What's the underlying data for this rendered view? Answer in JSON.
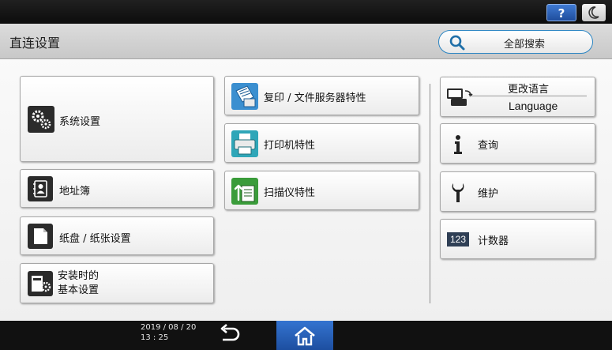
{
  "topbar": {
    "help_label": "?"
  },
  "header": {
    "title": "直连设置",
    "search_label": "全部搜索"
  },
  "tiles": {
    "system_settings": "系统设置",
    "address_book": "地址簿",
    "tray_paper": "纸盘 / 纸张设置",
    "install_basic_line1": "安装时的",
    "install_basic_line2": "基本设置",
    "copier_doc_server": "复印 / 文件服务器特性",
    "printer_features": "打印机特性",
    "scanner_features": "扫描仪特性",
    "change_language": "更改语言",
    "language": "Language",
    "inquiry": "查询",
    "maintenance": "维护",
    "counter": "计数器"
  },
  "icons": {
    "counter_icon_text": "123"
  },
  "bottombar": {
    "date": "2019 / 08 / 20",
    "time": "13 : 25"
  },
  "colors": {
    "accent_blue": "#2b85c3",
    "home_blue": "#2a62b8"
  }
}
